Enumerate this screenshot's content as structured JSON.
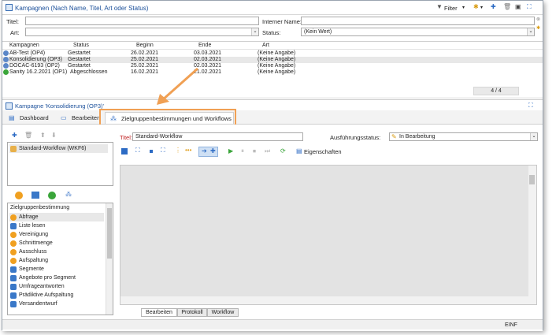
{
  "top_panel": {
    "title": "Kampagnen (Nach Name, Titel, Art oder Status)",
    "filter_label": "Filter",
    "title_label": "Titel:",
    "title_value": "",
    "internal_name_label": "Interner Name:",
    "internal_name_value": "",
    "type_label": "Art:",
    "type_value": "",
    "status_label": "Status:",
    "status_value": "(Kein Wert)"
  },
  "grid": {
    "columns": [
      "Kampagnen",
      "Status",
      "Beginn",
      "Ende",
      "Art"
    ],
    "rows": [
      {
        "name": "AB-Test (OP4)",
        "status": "Gestartet",
        "start": "26.02.2021",
        "end": "03.03.2021",
        "type": "(Keine Angabe)"
      },
      {
        "name": "Konsolidierung (OP3)",
        "status": "Gestartet",
        "start": "25.02.2021",
        "end": "02.03.2021",
        "type": "(Keine Angabe)"
      },
      {
        "name": "DOCAC-6193 (OP2)",
        "status": "Gestartet",
        "start": "25.02.2021",
        "end": "02.03.2021",
        "type": "(Keine Angabe)"
      },
      {
        "name": "Sanity 16.2.2021 (OP1)",
        "status": "Abgeschlossen",
        "start": "16.02.2021",
        "end": "21.02.2021",
        "type": "(Keine Angabe)"
      }
    ],
    "pager": "4 / 4"
  },
  "detail": {
    "title": "Kampagne 'Konsolidierung (OP3)'",
    "tabs": [
      "Dashboard",
      "Bearbeiten",
      "Zielgruppenbestimmungen und Workflows"
    ]
  },
  "workflow_list": [
    "Standard-Workflow (WKF6)"
  ],
  "activities": {
    "header": "Zielgruppenbestimmung",
    "items": [
      {
        "label": "Abfrage",
        "color": "#f0a020"
      },
      {
        "label": "Liste lesen",
        "color": "#3a78c8"
      },
      {
        "label": "Vereinigung",
        "color": "#f0a020"
      },
      {
        "label": "Schnittmenge",
        "color": "#f0a020"
      },
      {
        "label": "Ausschluss",
        "color": "#f0a020"
      },
      {
        "label": "Aufspaltung",
        "color": "#f0a020"
      },
      {
        "label": "Segmente",
        "color": "#3a78c8"
      },
      {
        "label": "Angebote pro Segment",
        "color": "#3a78c8"
      },
      {
        "label": "Umfrageantworten",
        "color": "#3a78c8"
      },
      {
        "label": "Prädiktive Aufspaltung",
        "color": "#3a78c8"
      },
      {
        "label": "Versandentwurf",
        "color": "#3a78c8"
      }
    ]
  },
  "editor": {
    "title_label": "Titel:",
    "title_value": "Standard-Workflow",
    "exec_status_label": "Ausführungsstatus:",
    "exec_status_value": "In Bearbeitung",
    "properties_label": "Eigenschaften",
    "bottom_tabs": [
      "Bearbeiten",
      "Protokoll",
      "Workflow"
    ]
  },
  "statusbar": {
    "lang": "EINF"
  }
}
